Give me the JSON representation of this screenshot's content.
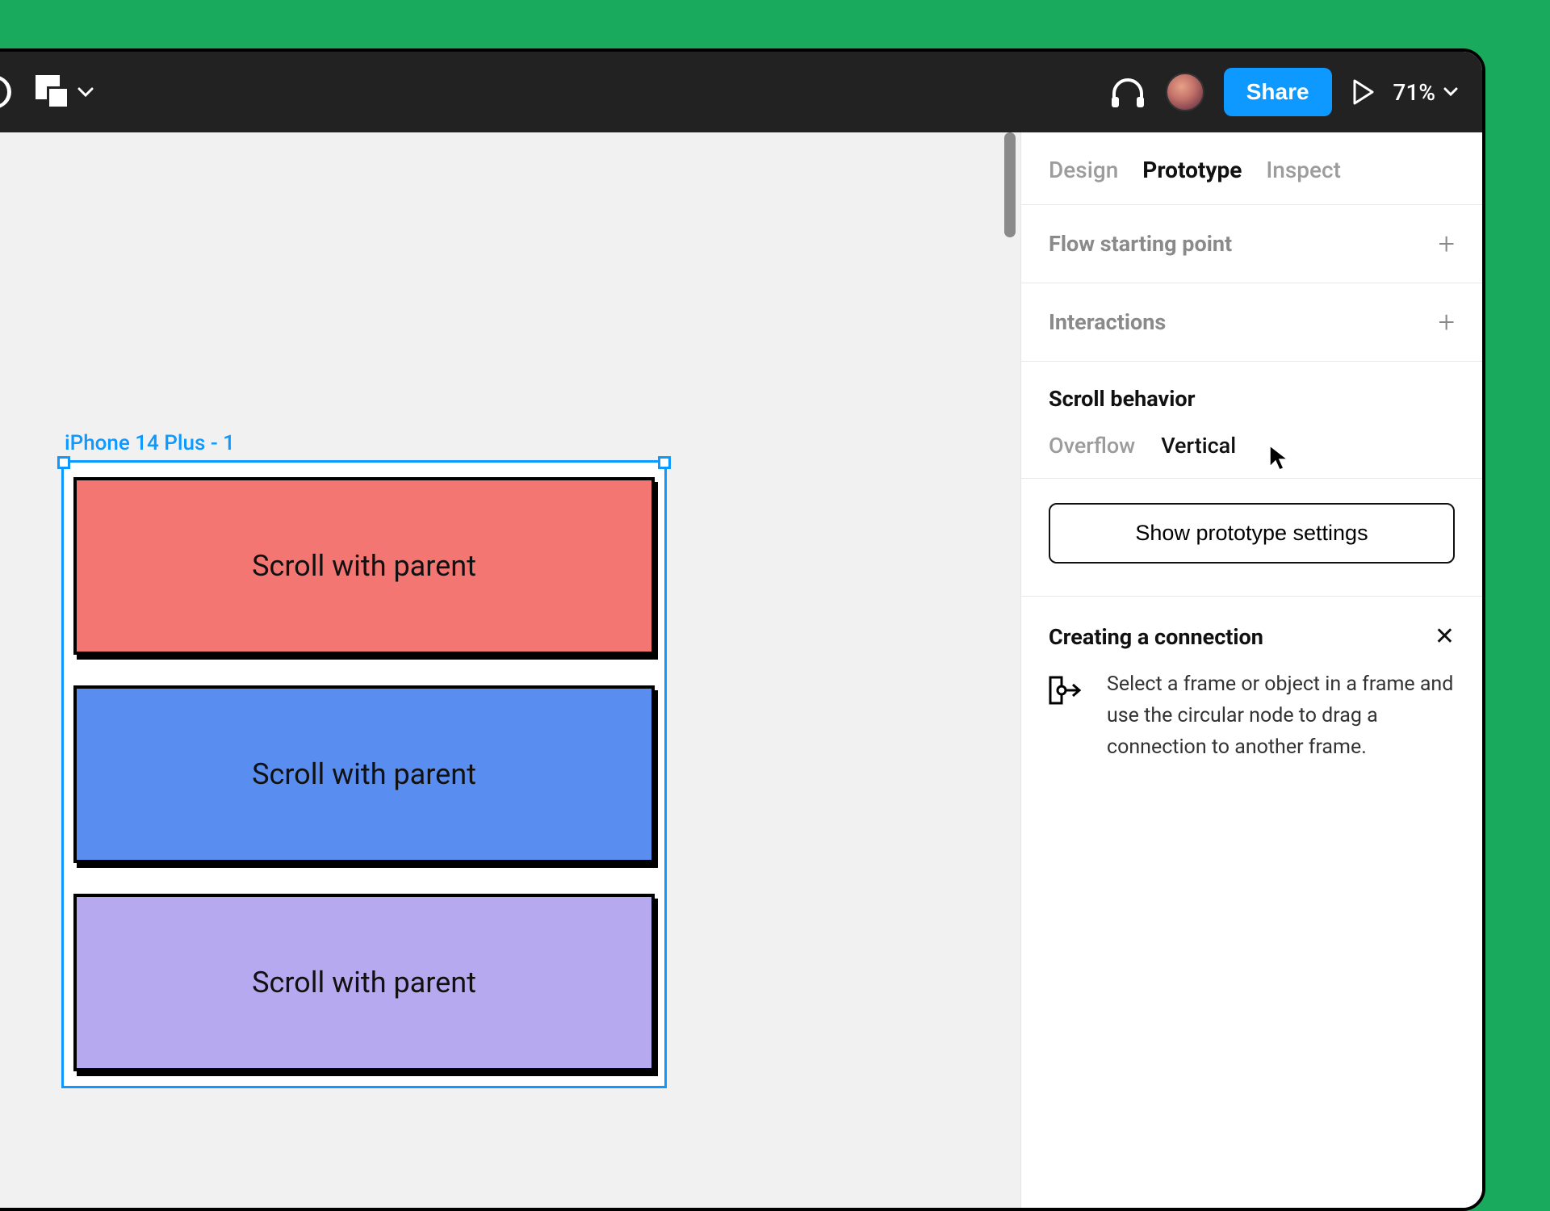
{
  "toolbar": {
    "share_label": "Share",
    "zoom": "71%"
  },
  "tabs": {
    "design": "Design",
    "prototype": "Prototype",
    "inspect": "Inspect"
  },
  "panel": {
    "flow_title": "Flow starting point",
    "interactions_title": "Interactions",
    "scroll_title": "Scroll behavior",
    "overflow_label": "Overflow",
    "overflow_value": "Vertical",
    "proto_button": "Show prototype settings",
    "help_title": "Creating a connection",
    "help_text": "Select a frame or object in a frame and use the circular node to drag a connection to another frame."
  },
  "canvas": {
    "frame_label": "iPhone 14 Plus - 1",
    "blocks": [
      {
        "label": "Scroll with parent"
      },
      {
        "label": "Scroll with parent"
      },
      {
        "label": "Scroll with parent"
      }
    ]
  }
}
